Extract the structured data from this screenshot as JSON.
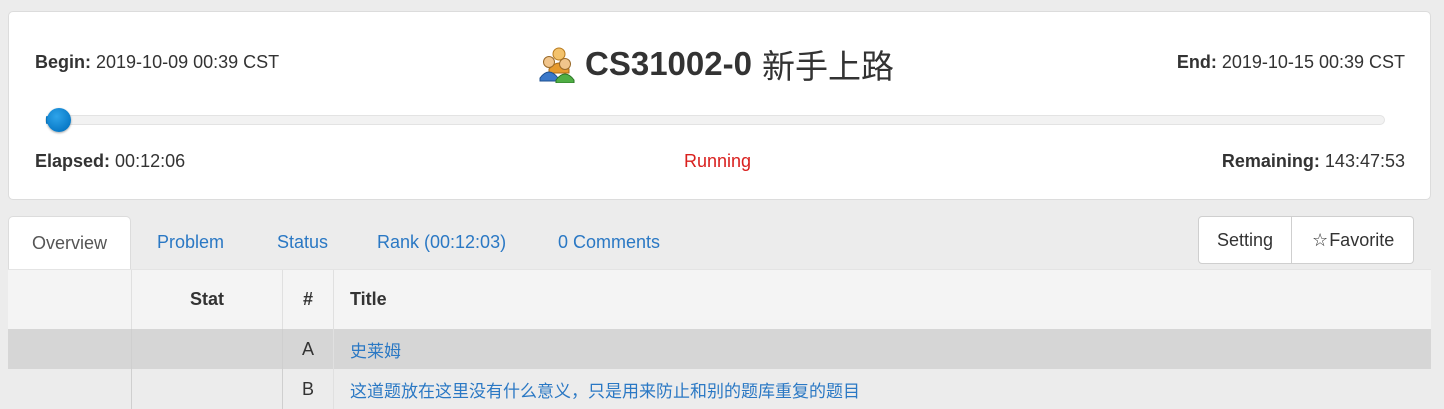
{
  "header": {
    "begin_label": "Begin:",
    "begin_value": "2019-10-09 00:39 CST",
    "end_label": "End:",
    "end_value": "2019-10-15 00:39 CST",
    "contest_code": "CS31002-0",
    "contest_name": "新手上路",
    "contest_icon": "users-group-icon",
    "progress_fraction": 0.0014,
    "elapsed_label": "Elapsed:",
    "elapsed_value": "00:12:06",
    "status": "Running",
    "remaining_label": "Remaining:",
    "remaining_value": "143:47:53"
  },
  "tabs": [
    {
      "label": "Overview",
      "active": true
    },
    {
      "label": "Problem",
      "active": false
    },
    {
      "label": "Status",
      "active": false
    },
    {
      "label": "Rank (00:12:03)",
      "active": false
    },
    {
      "label": "0 Comments",
      "active": false
    }
  ],
  "actions": {
    "setting_label": "Setting",
    "favorite_label": "Favorite",
    "favorite_icon": "star-outline-icon"
  },
  "table": {
    "headers": {
      "stat": "Stat",
      "num": "#",
      "title": "Title"
    },
    "rows": [
      {
        "num": "A",
        "title": "史莱姆"
      },
      {
        "num": "B",
        "title": "这道题放在这里没有什么意义，只是用来防止和别的题库重复的题目"
      }
    ]
  },
  "colors": {
    "accent": "#2a78c4",
    "running": "#d9201e",
    "progress": "#0a7fcf"
  }
}
